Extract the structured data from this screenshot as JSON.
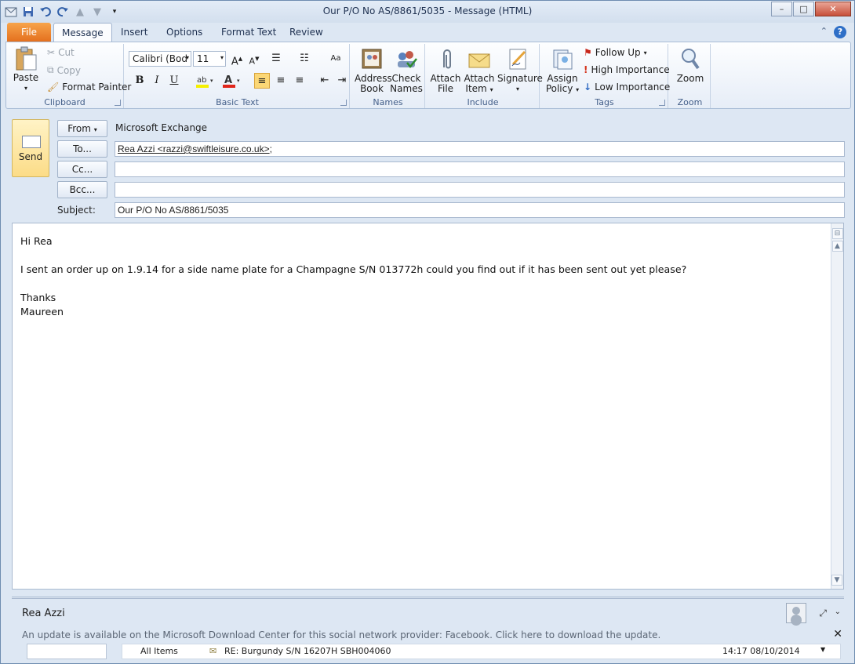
{
  "window": {
    "title": "Our P/O No AS/8861/5035  -  Message (HTML)",
    "minimize": "–",
    "maximize": "□",
    "close": "✕"
  },
  "qat": {
    "icons": [
      "app-icon",
      "save-icon",
      "undo-icon",
      "redo-icon",
      "up-icon",
      "down-icon",
      "customize-icon"
    ]
  },
  "tabs": [
    "File",
    "Message",
    "Insert",
    "Options",
    "Format Text",
    "Review"
  ],
  "ribbon": {
    "clipboard": {
      "label": "Clipboard",
      "paste": "Paste",
      "cut": "Cut",
      "copy": "Copy",
      "format_painter": "Format Painter"
    },
    "basic_text": {
      "label": "Basic Text",
      "font": "Calibri (Bod",
      "size": "11",
      "bold": "B",
      "italic": "I",
      "underline": "U"
    },
    "names": {
      "label": "Names",
      "address_book_1": "Address",
      "address_book_2": "Book",
      "check_names_1": "Check",
      "check_names_2": "Names"
    },
    "include": {
      "label": "Include",
      "attach_file_1": "Attach",
      "attach_file_2": "File",
      "attach_item_1": "Attach",
      "attach_item_2": "Item",
      "signature": "Signature"
    },
    "tags": {
      "label": "Tags",
      "assign_1": "Assign",
      "assign_2": "Policy",
      "follow_up": "Follow Up",
      "high": "High Importance",
      "low": "Low Importance"
    },
    "zoom": {
      "label": "Zoom",
      "zoom": "Zoom"
    }
  },
  "header": {
    "send": "Send",
    "from_btn": "From",
    "from_value": "Microsoft Exchange",
    "to_btn": "To...",
    "to_value": "Rea Azzi <razzi@swiftleisure.co.uk>",
    "to_suffix": ";",
    "cc_btn": "Cc...",
    "cc_value": "",
    "bcc_btn": "Bcc...",
    "bcc_value": "",
    "subject_label": "Subject:",
    "subject_value": "Our P/O No AS/8861/5035"
  },
  "message": {
    "lines": [
      "Hi Rea",
      "",
      "I sent an order up on 1.9.14 for a side name plate for a Champagne S/N 013772h could you find out if it has been sent out yet please?",
      "",
      "Thanks",
      "Maureen"
    ]
  },
  "people_pane": {
    "name": "Rea Azzi",
    "update_notice": "An update is available on the Microsoft Download Center for this social network provider: Facebook. Click here to download the update.",
    "feed_filter": "All Items",
    "feed_item": "RE: Burgundy S/N 16207H SBH004060",
    "feed_time": "14:17  08/10/2014"
  }
}
